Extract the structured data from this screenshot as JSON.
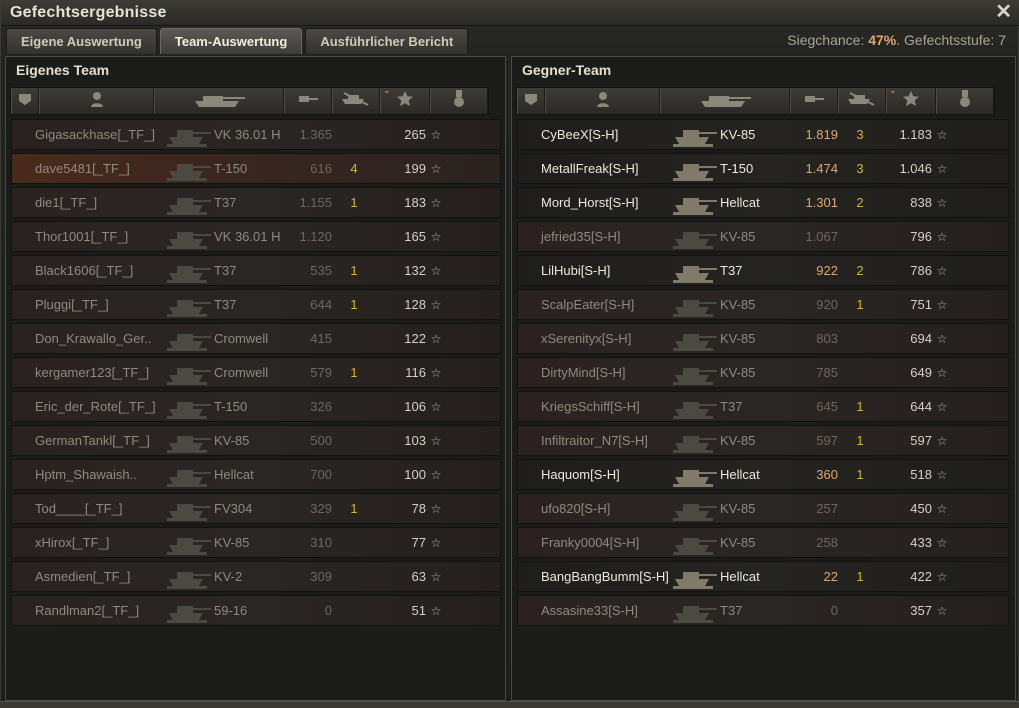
{
  "window": {
    "title": "Gefechtsergebnisse"
  },
  "tabs": [
    {
      "label": "Eigene Auswertung",
      "active": false
    },
    {
      "label": "Team-Auswertung",
      "active": true
    },
    {
      "label": "Ausführlicher Bericht",
      "active": false
    }
  ],
  "summary": {
    "chance_label": "Siegchance:",
    "chance_value": "47%",
    "tier_label": ". Gefechtsstufe: 7"
  },
  "own_team": {
    "title": "Eigenes Team",
    "rows": [
      {
        "name": "Gigasackhase[_TF_]",
        "tank": "VK 36.01 H",
        "damage": "1.365",
        "kills": "",
        "xp": "265"
      },
      {
        "name": "dave5481[_TF_]",
        "tank": "T-150",
        "damage": "616",
        "kills": "4",
        "xp": "199"
      },
      {
        "name": "die1[_TF_]",
        "tank": "T37",
        "damage": "1.155",
        "kills": "1",
        "xp": "183"
      },
      {
        "name": "Thor1001[_TF_]",
        "tank": "VK 36.01 H",
        "damage": "1.120",
        "kills": "",
        "xp": "165"
      },
      {
        "name": "Black1606[_TF_]",
        "tank": "T37",
        "damage": "535",
        "kills": "1",
        "xp": "132"
      },
      {
        "name": "Pluggi[_TF_]",
        "tank": "T37",
        "damage": "644",
        "kills": "1",
        "xp": "128"
      },
      {
        "name": "Don_Krawallo_Ger..",
        "tank": "Cromwell",
        "damage": "415",
        "kills": "",
        "xp": "122"
      },
      {
        "name": "kergamer123[_TF_]",
        "tank": "Cromwell",
        "damage": "579",
        "kills": "1",
        "xp": "116"
      },
      {
        "name": "Eric_der_Rote[_TF_]",
        "tank": "T-150",
        "damage": "326",
        "kills": "",
        "xp": "106"
      },
      {
        "name": "GermanTankl[_TF_]",
        "tank": "KV-85",
        "damage": "500",
        "kills": "",
        "xp": "103"
      },
      {
        "name": "Hptm_Shawaish..",
        "tank": "Hellcat",
        "damage": "700",
        "kills": "",
        "xp": "100"
      },
      {
        "name": "Tod____[_TF_]",
        "tank": "FV304",
        "damage": "329",
        "kills": "1",
        "xp": "78"
      },
      {
        "name": "xHirox[_TF_]",
        "tank": "KV-85",
        "damage": "310",
        "kills": "",
        "xp": "77"
      },
      {
        "name": "Asmedien[_TF_]",
        "tank": "KV-2",
        "damage": "309",
        "kills": "",
        "xp": "63"
      },
      {
        "name": "Randlman2[_TF_]",
        "tank": "59-16",
        "damage": "0",
        "kills": "",
        "xp": "51"
      }
    ]
  },
  "enemy_team": {
    "title": "Gegner-Team",
    "rows": [
      {
        "name": "CyBeeX[S-H]",
        "tank": "KV-85",
        "damage": "1.819",
        "kills": "3",
        "xp": "1.183"
      },
      {
        "name": "MetallFreak[S-H]",
        "tank": "T-150",
        "damage": "1.474",
        "kills": "3",
        "xp": "1.046"
      },
      {
        "name": "Mord_Horst[S-H]",
        "tank": "Hellcat",
        "damage": "1.301",
        "kills": "2",
        "xp": "838"
      },
      {
        "name": "jefried35[S-H]",
        "tank": "KV-85",
        "damage": "1.067",
        "kills": "",
        "xp": "796"
      },
      {
        "name": "LilHubi[S-H]",
        "tank": "T37",
        "damage": "922",
        "kills": "2",
        "xp": "786"
      },
      {
        "name": "ScalpEater[S-H]",
        "tank": "KV-85",
        "damage": "920",
        "kills": "1",
        "xp": "751"
      },
      {
        "name": "xSerenityx[S-H]",
        "tank": "KV-85",
        "damage": "803",
        "kills": "",
        "xp": "694"
      },
      {
        "name": "DirtyMind[S-H]",
        "tank": "KV-85",
        "damage": "785",
        "kills": "",
        "xp": "649"
      },
      {
        "name": "KriegsSchiff[S-H]",
        "tank": "T37",
        "damage": "645",
        "kills": "1",
        "xp": "644"
      },
      {
        "name": "Infiltraitor_N7[S-H]",
        "tank": "KV-85",
        "damage": "597",
        "kills": "1",
        "xp": "597"
      },
      {
        "name": "Haquom[S-H]",
        "tank": "Hellcat",
        "damage": "360",
        "kills": "1",
        "xp": "518"
      },
      {
        "name": "ufo820[S-H]",
        "tank": "KV-85",
        "damage": "257",
        "kills": "",
        "xp": "450"
      },
      {
        "name": "Franky0004[S-H]",
        "tank": "KV-85",
        "damage": "258",
        "kills": "",
        "xp": "433"
      },
      {
        "name": "BangBangBumm[S-H]",
        "tank": "Hellcat",
        "damage": "22",
        "kills": "1",
        "xp": "422"
      },
      {
        "name": "Assasine33[S-H]",
        "tank": "T37",
        "damage": "0",
        "kills": "",
        "xp": "357"
      }
    ]
  },
  "header_icons": [
    "platoon-icon",
    "player-icon",
    "tank-icon",
    "damage-icon",
    "kills-icon",
    "xp-star-icon",
    "medal-icon"
  ],
  "colors": {
    "accent": "#e0a76a",
    "kills": "#d6b23a",
    "row_highlight": "#4a2a1c"
  }
}
